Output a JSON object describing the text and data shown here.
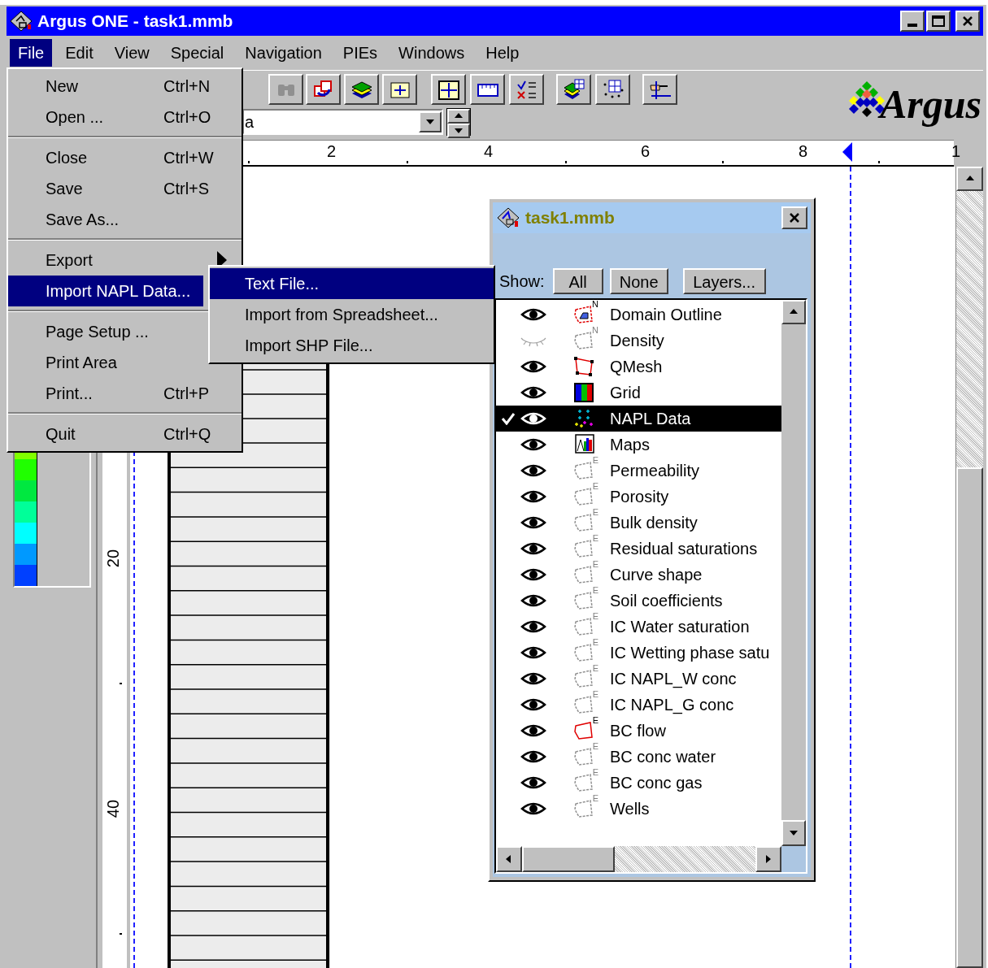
{
  "window": {
    "title": "Argus ONE - task1.mmb"
  },
  "menu_bar": [
    {
      "label": "File",
      "selected": true
    },
    {
      "label": "Edit",
      "selected": false
    },
    {
      "label": "View",
      "selected": false
    },
    {
      "label": "Special",
      "selected": false
    },
    {
      "label": "Navigation",
      "selected": false
    },
    {
      "label": "PIEs",
      "selected": false
    },
    {
      "label": "Windows",
      "selected": false
    },
    {
      "label": "Help",
      "selected": false
    }
  ],
  "toolbar": {
    "combo_value": "a"
  },
  "logo": {
    "text": "Argus"
  },
  "ruler": {
    "labels": [
      "2",
      "4",
      "6",
      "8",
      "1"
    ]
  },
  "vertical_ruler": {
    "labels": [
      "20",
      "40"
    ]
  },
  "file_menu": {
    "groups": [
      [
        {
          "label": "New",
          "shortcut": "Ctrl+N",
          "selected": false,
          "submenu_arrow": false
        },
        {
          "label": "Open ...",
          "shortcut": "Ctrl+O",
          "selected": false,
          "submenu_arrow": false
        }
      ],
      [
        {
          "label": "Close",
          "shortcut": "Ctrl+W",
          "selected": false,
          "submenu_arrow": false
        },
        {
          "label": "Save",
          "shortcut": "Ctrl+S",
          "selected": false,
          "submenu_arrow": false
        },
        {
          "label": "Save As...",
          "selected": false,
          "submenu_arrow": false
        }
      ],
      [
        {
          "label": "Export",
          "selected": false,
          "submenu_arrow": true
        },
        {
          "label": "Import NAPL Data...",
          "selected": true,
          "submenu_arrow": false
        }
      ],
      [
        {
          "label": "Page Setup ...",
          "selected": false,
          "submenu_arrow": false
        },
        {
          "label": "Print Area",
          "selected": false,
          "submenu_arrow": false
        },
        {
          "label": "Print...",
          "shortcut": "Ctrl+P",
          "selected": false,
          "submenu_arrow": false
        }
      ],
      [
        {
          "label": "Quit",
          "shortcut": "Ctrl+Q",
          "selected": false,
          "submenu_arrow": false
        }
      ]
    ]
  },
  "submenu": {
    "items": [
      {
        "label": "Text File...",
        "selected": true
      },
      {
        "label": "Import from Spreadsheet...",
        "selected": false
      },
      {
        "label": "Import SHP File...",
        "selected": false
      }
    ]
  },
  "layers_window": {
    "title": "task1.mmb",
    "show_label": "Show:",
    "buttons": [
      "All",
      "None",
      "Layers..."
    ],
    "layers": [
      {
        "name": "Domain Outline",
        "visible": true,
        "kind": "domain",
        "letter": "N",
        "selected": false
      },
      {
        "name": "Density",
        "visible": false,
        "kind": "outline",
        "letter": "N",
        "selected": false
      },
      {
        "name": "QMesh",
        "visible": true,
        "kind": "mesh",
        "selected": false
      },
      {
        "name": "Grid",
        "visible": true,
        "kind": "grid",
        "selected": false
      },
      {
        "name": "NAPL Data",
        "visible": true,
        "kind": "points",
        "selected": true
      },
      {
        "name": "Maps",
        "visible": true,
        "kind": "maps",
        "selected": false
      },
      {
        "name": "Permeability",
        "visible": true,
        "kind": "outline",
        "letter": "E",
        "selected": false
      },
      {
        "name": "Porosity",
        "visible": true,
        "kind": "outline",
        "letter": "E",
        "selected": false
      },
      {
        "name": "Bulk density",
        "visible": true,
        "kind": "outline",
        "letter": "E",
        "selected": false
      },
      {
        "name": "Residual saturations",
        "visible": true,
        "kind": "outline",
        "letter": "E",
        "selected": false
      },
      {
        "name": "Curve shape",
        "visible": true,
        "kind": "outline",
        "letter": "E",
        "selected": false
      },
      {
        "name": "Soil coefficients",
        "visible": true,
        "kind": "outline",
        "letter": "E",
        "selected": false
      },
      {
        "name": "IC Water saturation",
        "visible": true,
        "kind": "outline",
        "letter": "E",
        "selected": false
      },
      {
        "name": "IC Wetting phase satu",
        "visible": true,
        "kind": "outline",
        "letter": "E",
        "selected": false
      },
      {
        "name": "IC NAPL_W conc",
        "visible": true,
        "kind": "outline",
        "letter": "E",
        "selected": false
      },
      {
        "name": "IC NAPL_G conc",
        "visible": true,
        "kind": "outline",
        "letter": "E",
        "selected": false
      },
      {
        "name": "BC flow",
        "visible": true,
        "kind": "outline-red",
        "letter": "E",
        "selected": false
      },
      {
        "name": "BC conc water",
        "visible": true,
        "kind": "outline",
        "letter": "E",
        "selected": false
      },
      {
        "name": "BC conc gas",
        "visible": true,
        "kind": "outline",
        "letter": "E",
        "selected": false
      },
      {
        "name": "Wells",
        "visible": true,
        "kind": "outline",
        "letter": "E",
        "selected": false
      }
    ]
  }
}
